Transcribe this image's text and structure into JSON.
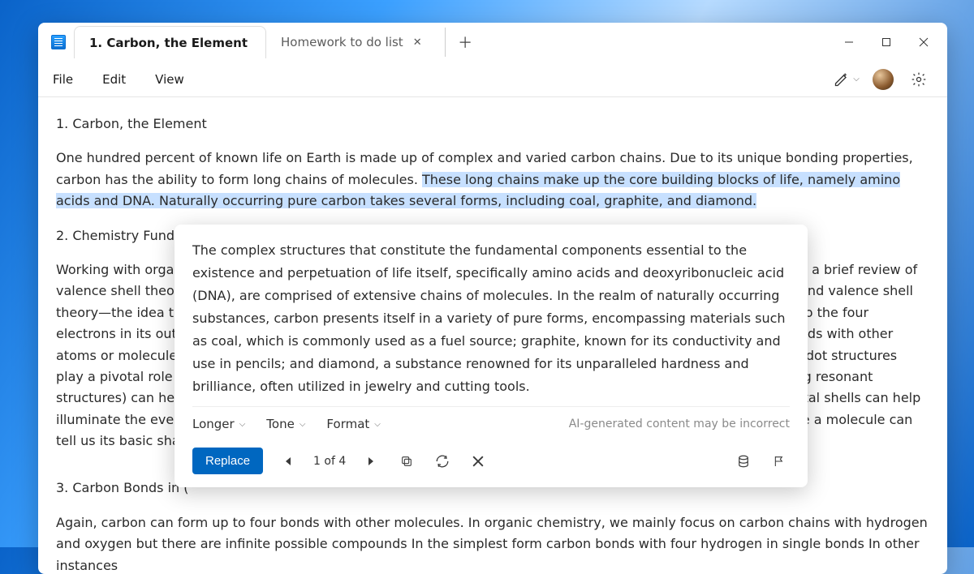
{
  "tabs": {
    "active": "1. Carbon, the Element",
    "inactive": "Homework to do list"
  },
  "menu": {
    "file": "File",
    "edit": "Edit",
    "view": "View"
  },
  "doc": {
    "h1": "1. Carbon, the Element",
    "p1a": "One hundred percent of known life on Earth is made up of complex and varied carbon chains. Due to its unique bonding properties, carbon has the ability to form long chains of molecules. ",
    "p1b_hl": "These long chains make up the core building blocks of life, namely amino acids and DNA. Naturally occurring pure carbon takes several forms, including coal, graphite, and diamond.",
    "h2": "2. Chemistry Fundan",
    "p2_left": "Working with organi\nvalence shell theory,\ntheory—the idea tha\nelectrons in its outer\natoms or molecules.\nplay a pivotal role in\nstructures) can help\nilluminate the event\ntell us its basic shap",
    "p2_right": "de a brief review of\nound valence shell\n: to the four\nonds with other\nis dot structures\ning resonant\nbital shells can help\nise a molecule can",
    "h3": "3. Carbon Bonds in (",
    "p3": "Again, carbon can form up to four bonds with other molecules. In organic chemistry, we mainly focus on carbon chains with hydrogen and oxygen but there are infinite possible compounds In the simplest form carbon bonds with four hydrogen in single bonds In other instances"
  },
  "popup": {
    "body": "The complex structures that constitute the fundamental components essential to the existence and perpetuation of life itself, specifically amino acids and deoxyribonucleic acid (DNA), are comprised of extensive chains of molecules. In the realm of naturally occurring substances, carbon presents itself in a variety of pure forms, encompassing materials such as coal, which is commonly used as a fuel source; graphite, known for its conductivity and use in pencils; and diamond, a substance renowned for its unparalleled hardness and brilliance, often utilized in jewelry and cutting tools.",
    "opts": {
      "longer": "Longer",
      "tone": "Tone",
      "format": "Format"
    },
    "ai_note": "AI-generated content may be incorrect",
    "replace": "Replace",
    "pager": "1 of 4"
  }
}
